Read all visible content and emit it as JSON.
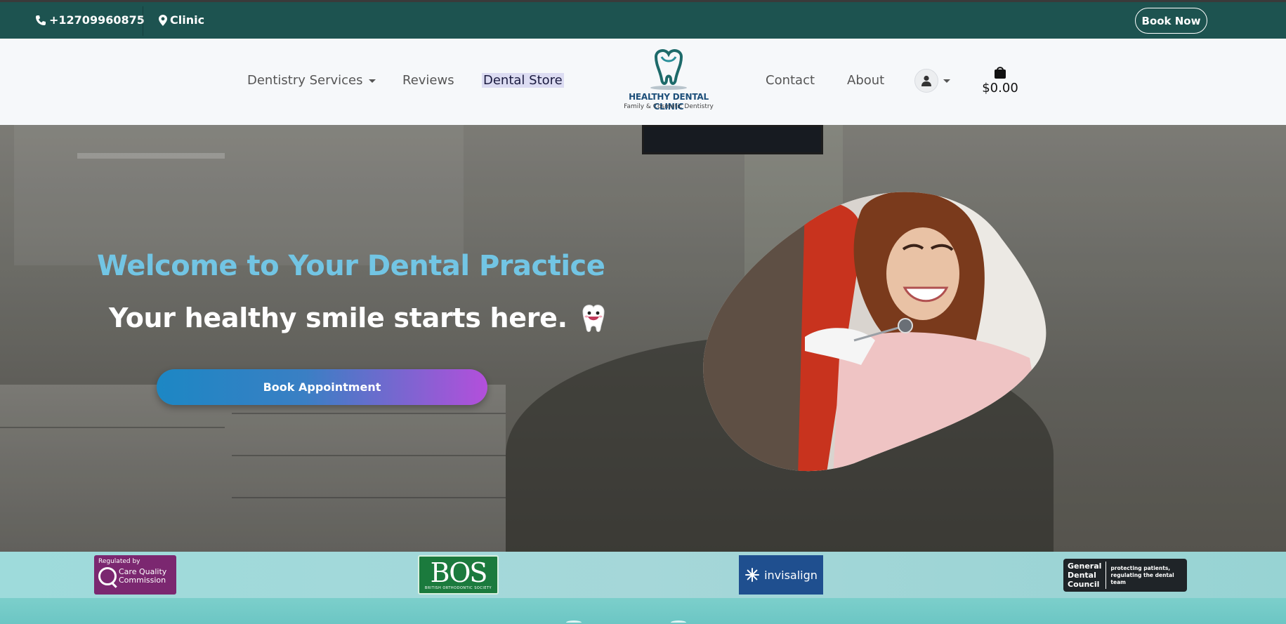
{
  "topbar": {
    "phone": "+12709960875",
    "location": "Clinic",
    "book_now": "Book Now"
  },
  "nav": {
    "left_items": [
      "Dentistry Services",
      "Reviews",
      "Dental Store"
    ],
    "right_items": [
      "Contact",
      "About"
    ],
    "cart_total": "$0.00"
  },
  "logo": {
    "name": "HEALTHY DENTAL CLINIC",
    "tagline": "Family & Cosmetic Dentistry"
  },
  "hero": {
    "title": "Welcome to Your Dental Practice",
    "subtitle": "Your healthy smile starts here.",
    "cta": "Book Appointment"
  },
  "accreditations": {
    "cqc": {
      "top": "Regulated by",
      "line1": "Care Quality",
      "line2": "Commission"
    },
    "bos": {
      "big": "BOS",
      "small": "BRITISH ORTHODONTIC SOCIETY"
    },
    "invisalign": {
      "label": "invisalign"
    },
    "gdc": {
      "line1": "General",
      "line2": "Dental",
      "line3": "Council",
      "right1": "protecting patients,",
      "right2": "regulating the dental team"
    }
  },
  "colors": {
    "topbar": "#1d5350",
    "title": "#72c5e4",
    "cta_start": "#1c87c4",
    "cta_end": "#b34fdb",
    "strip": "#9edbdb"
  }
}
